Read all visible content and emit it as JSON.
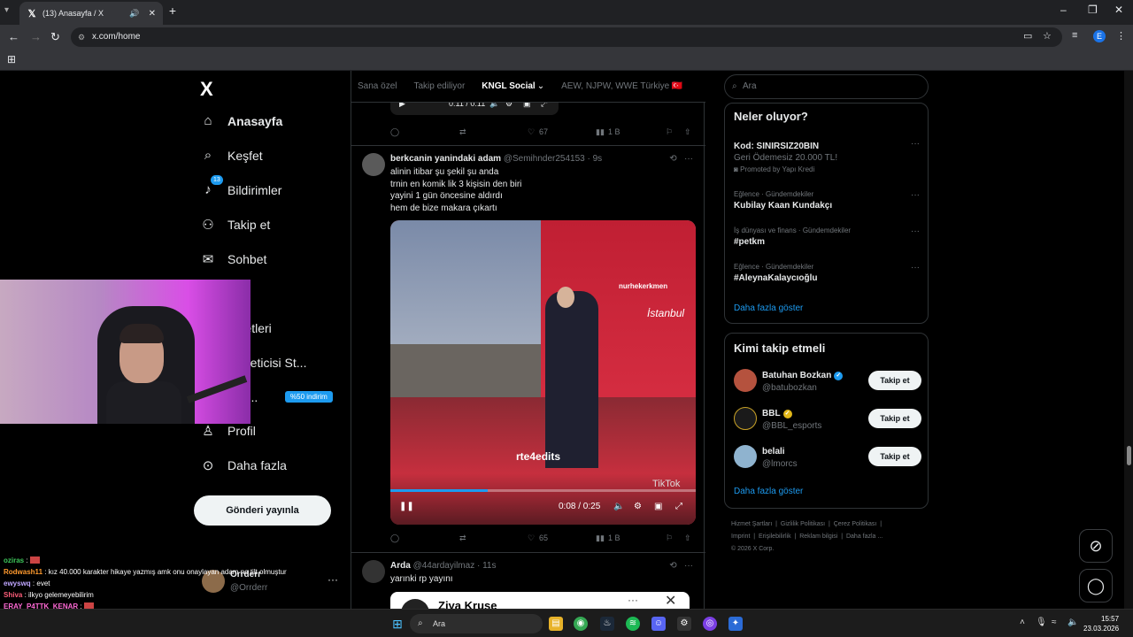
{
  "browser": {
    "tab_title": "(13) Anasayfa / X",
    "url": "x.com/home",
    "profile_letter": "E"
  },
  "sidebar": {
    "logo": "X",
    "items": [
      {
        "label": "Anasayfa",
        "icon": "home-icon"
      },
      {
        "label": "Keşfet",
        "icon": "search-icon"
      },
      {
        "label": "Bildirimler",
        "icon": "bell-icon",
        "badge": "13"
      },
      {
        "label": "Takip et",
        "icon": "add-person-icon"
      },
      {
        "label": "Sohbet",
        "icon": "mail-icon"
      },
      {
        "label": "k",
        "icon": "grok-icon"
      },
      {
        "label": "şaretleri",
        "icon": "bookmark-icon"
      },
      {
        "label": "k Üreticisi St...",
        "icon": "creator-icon"
      },
      {
        "label": "miu...",
        "icon": "premium-icon",
        "promo": "%50 indirim"
      },
      {
        "label": "Profil",
        "icon": "profile-icon"
      },
      {
        "label": "Daha fazla",
        "icon": "more-icon"
      }
    ],
    "post_button": "Gönderi yayınla",
    "account": {
      "name": "Orrderr",
      "handle": "@Orrderr"
    }
  },
  "feed": {
    "tabs": [
      "Sana özel",
      "Takip ediliyor",
      "KNGL Social",
      "AEW, NJPW, WWE Türkiye 🇹🇷"
    ],
    "active_tab": "KNGL Social",
    "audio_time": "0:11 / 0:11",
    "top_actions": {
      "likes": "67",
      "views": "1 B"
    },
    "tweets": [
      {
        "name": "berkcanin yanindaki adam",
        "handle": "@Semihnder254153",
        "time": "9s",
        "text": "alinin itibar şu şekil şu anda\ntrnin en komik lik 3 kişisin den biri\nyayini 1 gün öncesine aldırdı\nhem de bize makara çıkartı",
        "video": {
          "time": "0:08 / 0:25",
          "progress": 0.32,
          "watermark": "rte4edits",
          "brand": "nurhekerkmen",
          "brand2": "İstanbul",
          "tiktok": "TikTok"
        },
        "likes": "65",
        "views": "1 B"
      },
      {
        "name": "Arda",
        "handle": "@44ardayilmaz",
        "time": "11s",
        "text": "yarınki rp yayını",
        "card_name": "Ziya Kruse"
      }
    ]
  },
  "right": {
    "search_placeholder": "Ara",
    "trending_title": "Neler oluyor?",
    "trends": [
      {
        "category": "",
        "title": "Kod: SINIRSIZ20BIN",
        "subtitle": "Geri Ödemesiz 20.000 TL!",
        "promoted": "Promoted by Yapı Kredi"
      },
      {
        "category": "Eğlence · Gündemdekiler",
        "title": "Kubilay Kaan Kundakçı"
      },
      {
        "category": "İş dünyası ve finans · Gündemdekiler",
        "title": "#petkm"
      },
      {
        "category": "Eğlence · Gündemdekiler",
        "title": "#AleynaKalaycıoğlu"
      }
    ],
    "show_more": "Daha fazla göster",
    "who_title": "Kimi takip etmeli",
    "who": [
      {
        "name": "Batuhan Bozkan",
        "handle": "@batubozkan",
        "verified": "blue",
        "button": "Takip et"
      },
      {
        "name": "BBL",
        "handle": "@BBL_esports",
        "verified": "gold",
        "button": "Takip et"
      },
      {
        "name": "belali",
        "handle": "@lmorcs",
        "verified": "",
        "button": "Takip et"
      }
    ],
    "who_more": "Daha fazla göster",
    "footer": [
      "Hizmet Şartları",
      "Gizlilik Politikası",
      "Çerez Politikası",
      "Imprint",
      "Erişilebilirlik",
      "Reklam bilgisi",
      "Daha fazla ...",
      "© 2026 X Corp."
    ]
  },
  "chat": [
    {
      "user": "oziras",
      "color": "#3ec85b",
      "msg": ":"
    },
    {
      "user": "Rodwash11",
      "color": "#ff9a2e",
      "msg": ": kız 40.000 karakter hikaye yazmış amk onu onaylayan adam ne tilt olmuştur"
    },
    {
      "user": "ewyswq",
      "color": "#bfa6ff",
      "msg": ": evet"
    },
    {
      "user": "Shiva",
      "color": "#ff5e7a",
      "msg": ": ilkyo gelemeyebilirim"
    },
    {
      "user": "ERAY_P4TTK_KENAR",
      "color": "#ff6ad5",
      "msg": ":"
    }
  ],
  "taskbar": {
    "search": "Ara",
    "time": "15:57",
    "date": "23.03.2026"
  }
}
